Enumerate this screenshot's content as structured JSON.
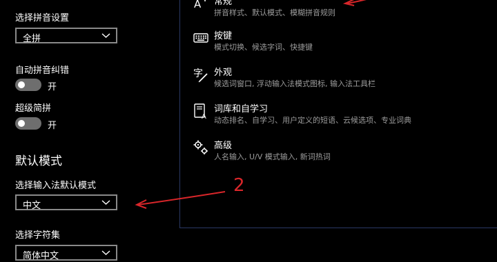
{
  "left": {
    "pinyin_setting_label": "选择拼音设置",
    "pinyin_setting_value": "全拼",
    "auto_correct_label": "自动拼音纠错",
    "auto_correct_state": "开",
    "super_abbrev_label": "超级简拼",
    "super_abbrev_state": "开",
    "default_mode_heading": "默认模式",
    "ime_default_mode_label": "选择输入法默认模式",
    "ime_default_mode_value": "中文",
    "charset_label": "选择字符集",
    "charset_value": "简体中文"
  },
  "panel": {
    "items": [
      {
        "title": "常规",
        "desc": "拼音样式、默认模式、模糊拼音规则",
        "icon": "general-text-icon"
      },
      {
        "title": "按键",
        "desc": "模式切换、候选字词、快捷键",
        "icon": "keyboard-icon"
      },
      {
        "title": "外观",
        "desc": "候选词窗口, 浮动输入法模式图标, 输入法工具栏",
        "icon": "appearance-pen-icon"
      },
      {
        "title": "词库和自学习",
        "desc": "动态排名、自学习、用户定义的短语、云候选项、专业词典",
        "icon": "lexicon-book-icon"
      },
      {
        "title": "高级",
        "desc": "人名输入, U/V 模式输入, 新词热词",
        "icon": "gears-icon"
      }
    ]
  },
  "annotations": {
    "marker_2": "2",
    "color": "#d9262a"
  }
}
